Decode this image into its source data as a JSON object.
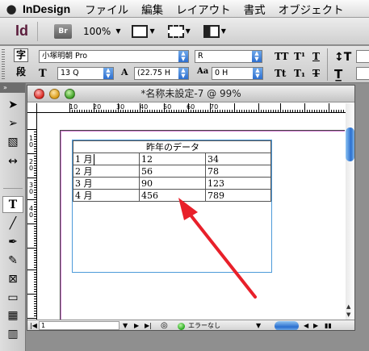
{
  "menubar": {
    "apple_icon": "apple-icon",
    "app_name": "InDesign",
    "items": [
      "ファイル",
      "編集",
      "レイアウト",
      "書式",
      "オブジェクト"
    ]
  },
  "appbar": {
    "app_logo": "Id",
    "bridge_label": "Br",
    "zoom": "100%",
    "zoom_icon": "chevron-down-icon"
  },
  "control": {
    "char_label": "字",
    "para_label": "段",
    "font_family": "小塚明朝 Pro",
    "font_style": "R",
    "font_size": "13 Q",
    "leading": "(22.75 H",
    "tracking": "0 H",
    "text_icons": [
      "TT",
      "T¹",
      "T",
      "Tt",
      "T₁",
      "T"
    ]
  },
  "toolbox": {
    "header": "»",
    "tools": [
      {
        "name": "selection-tool-icon",
        "glyph": "➤"
      },
      {
        "name": "direct-selection-tool-icon",
        "glyph": "➢"
      },
      {
        "name": "page-tool-icon",
        "glyph": "▧"
      },
      {
        "name": "gap-tool-icon",
        "glyph": "↔"
      },
      {
        "name": "type-tool-icon",
        "glyph": "T"
      },
      {
        "name": "line-tool-icon",
        "glyph": "╱"
      },
      {
        "name": "pen-tool-icon",
        "glyph": "✒"
      },
      {
        "name": "pencil-tool-icon",
        "glyph": "✎"
      },
      {
        "name": "rectangle-frame-tool-icon",
        "glyph": "⊠"
      },
      {
        "name": "rectangle-tool-icon",
        "glyph": "▭"
      },
      {
        "name": "frame-grid-tool-icon",
        "glyph": "▦"
      },
      {
        "name": "vertical-grid-tool-icon",
        "glyph": "▥"
      }
    ]
  },
  "document": {
    "title": "*名称未設定-7 @ 99%",
    "ruler_h": [
      "10",
      "20",
      "30",
      "40",
      "50",
      "60",
      "70"
    ],
    "ruler_v": [
      "1 0",
      "2 0",
      "3 0",
      "4 0"
    ],
    "page_number": "1",
    "preflight": "エラーなし"
  },
  "table": {
    "title": "昨年のデータ",
    "rows": [
      [
        "1 月",
        "12",
        "34"
      ],
      [
        "2 月",
        "56",
        "78"
      ],
      [
        "3 月",
        "90",
        "123"
      ],
      [
        "4 月",
        "456",
        "789"
      ]
    ]
  },
  "annotation": {
    "arrow_color": "#e8202a"
  },
  "colors": {
    "frame": "#4d9ad9",
    "margin": "#d37bd3",
    "accent": "#2a6fcf"
  }
}
